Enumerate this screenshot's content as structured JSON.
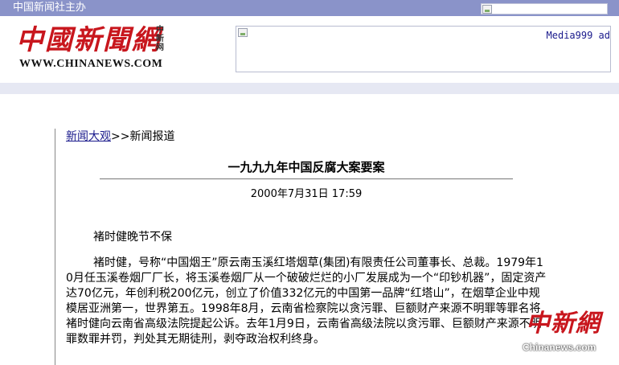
{
  "topbar": {
    "org_text": "中国新闻社主办"
  },
  "logo": {
    "cn_text": "中國新聞網",
    "mini_text": "中新网",
    "url_text": "WWW.CHINANEWS.COM"
  },
  "ad": {
    "text": "Media999 ad"
  },
  "breadcrumb": {
    "parent_label": "新闻大观",
    "separator": ">>",
    "current_label": "新闻报道"
  },
  "article": {
    "title": "一九九九年中国反腐大案要案",
    "date": "2000年7月31日  17:59",
    "heading": "褚时健晚节不保",
    "body": "褚时健，号称“中国烟王”原云南玉溪红塔烟草(集团)有限责任公司董事长、总裁。1979年10月任玉溪卷烟厂厂长，将玉溪卷烟厂从一个破破烂烂的小厂发展成为一个“印钞机器”，固定资产达70亿元，年创利税200亿元，创立了价值332亿元的中国第一品牌“红塔山”，在烟草企业中规模居亚洲第一，世界第五。1998年8月，云南省检察院以贪污罪、巨额财产来源不明罪等罪名将褚时健向云南省高级法院提起公诉。去年1月9日，云南省高级法院以贪污罪、巨额财产来源不明罪数罪并罚，判处其无期徒刑，剥夺政治权利终身。"
  },
  "watermark": {
    "cn_text": "中新網",
    "en_text": "Chinanews.com"
  },
  "colors": {
    "topbar": "#8a93c9",
    "logo_red": "#c8161d",
    "link": "#1a1a8c",
    "stripe": "#e6e8f3"
  }
}
